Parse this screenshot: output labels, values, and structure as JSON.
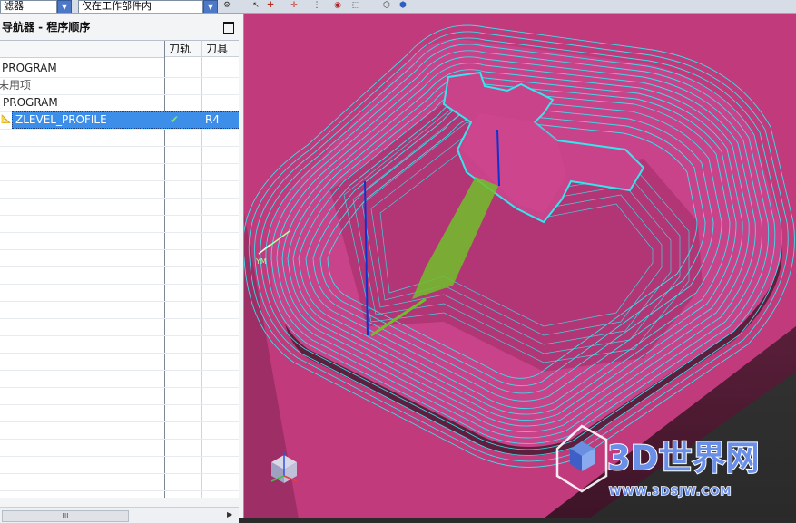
{
  "toolbar": {
    "filter_combo_text": "滤器",
    "scope_combo_text": "仅在工作部件内"
  },
  "navigator": {
    "title": "导航器 - 程序顺序",
    "columns": {
      "name": "",
      "toolpath": "刀轨",
      "tool": "刀具"
    },
    "rows": [
      {
        "name": "PROGRAM",
        "toolpath": "",
        "tool": ""
      },
      {
        "name": "未用项",
        "toolpath": "",
        "tool": ""
      },
      {
        "name": "PROGRAM",
        "toolpath": "",
        "tool": ""
      },
      {
        "name": "ZLEVEL_PROFILE",
        "toolpath": "✔",
        "tool": "R4",
        "selected": true
      }
    ],
    "scrollbar_thumb": "III"
  },
  "viewport": {
    "axis_label": "YM",
    "watermark_main": "3D世界网",
    "watermark_url": "WWW.3DSJW.COM"
  },
  "colors": {
    "part_magenta": "#c03a7c",
    "toolpath_cyan": "#34e6ee",
    "selection_blue": "#3d8ee8"
  }
}
